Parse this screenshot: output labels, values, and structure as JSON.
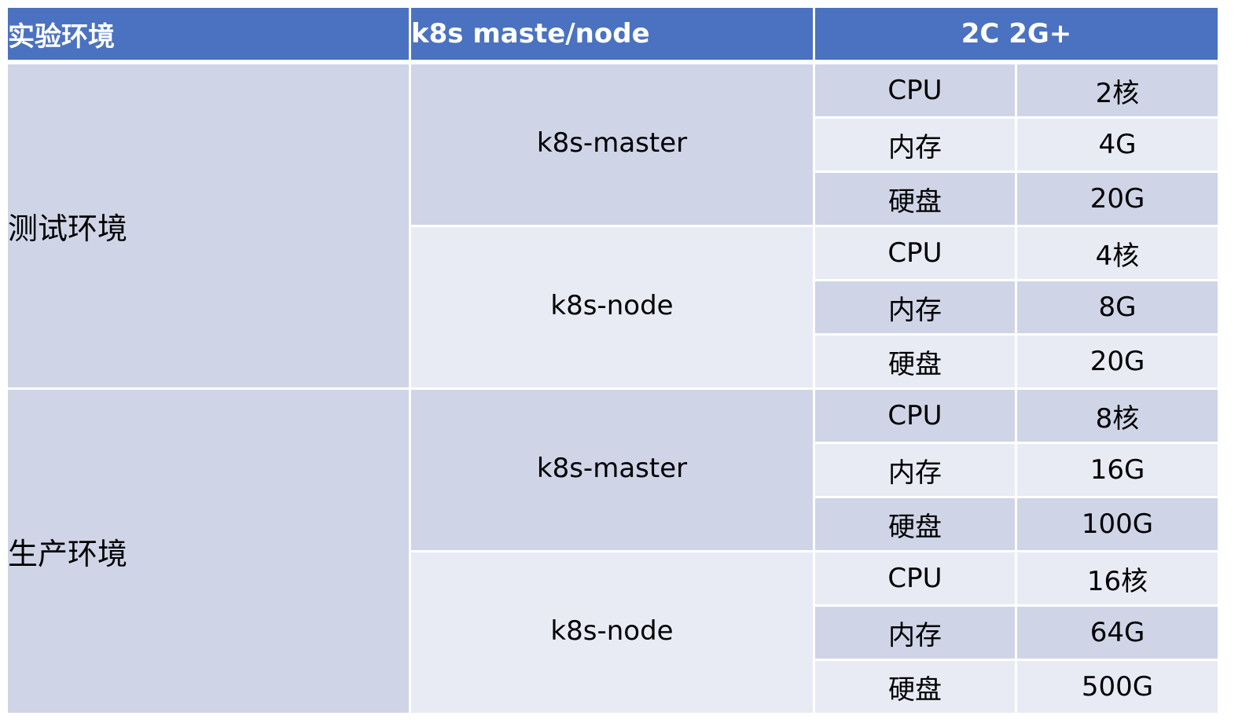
{
  "header": {
    "environment": "实验环境",
    "role": "k8s maste/node",
    "spec": "2C 2G+"
  },
  "environments": [
    {
      "name": "测试环境",
      "roles": [
        {
          "name": "k8s-master",
          "resources": [
            {
              "label": "CPU",
              "value": "2核"
            },
            {
              "label": "内存",
              "value": "4G"
            },
            {
              "label": "硬盘",
              "value": "20G"
            }
          ]
        },
        {
          "name": "k8s-node",
          "resources": [
            {
              "label": "CPU",
              "value": "4核"
            },
            {
              "label": "内存",
              "value": "8G"
            },
            {
              "label": "硬盘",
              "value": "20G"
            }
          ]
        }
      ]
    },
    {
      "name": "生产环境",
      "roles": [
        {
          "name": "k8s-master",
          "resources": [
            {
              "label": "CPU",
              "value": "8核"
            },
            {
              "label": "内存",
              "value": "16G"
            },
            {
              "label": "硬盘",
              "value": "100G"
            }
          ]
        },
        {
          "name": "k8s-node",
          "resources": [
            {
              "label": "CPU",
              "value": "16核"
            },
            {
              "label": "内存",
              "value": "64G"
            },
            {
              "label": "硬盘",
              "value": "500G"
            }
          ]
        }
      ]
    }
  ],
  "colors": {
    "header_bg": "#4a72c0",
    "cell_dark": "#cfd5e7",
    "cell_light": "#e8ebf4"
  }
}
